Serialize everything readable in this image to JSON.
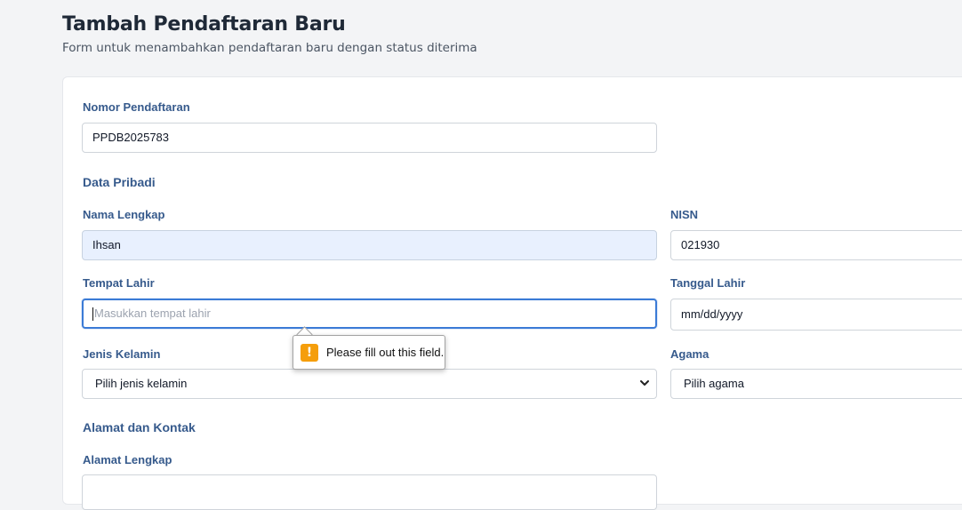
{
  "header": {
    "title": "Tambah Pendaftaran Baru",
    "subtitle": "Form untuk menambahkan pendaftaran baru dengan status diterima"
  },
  "form": {
    "nomor": {
      "label": "Nomor Pendaftaran",
      "value": "PPDB2025783"
    },
    "section_pribadi": "Data Pribadi",
    "nama": {
      "label": "Nama Lengkap",
      "value": "Ihsan"
    },
    "nisn": {
      "label": "NISN",
      "value": "021930"
    },
    "tempat_lahir": {
      "label": "Tempat Lahir",
      "value": "",
      "placeholder": "Masukkan tempat lahir"
    },
    "tanggal_lahir": {
      "label": "Tanggal Lahir",
      "value": "mm/dd/yyyy"
    },
    "jenis_kelamin": {
      "label": "Jenis Kelamin",
      "value": "Pilih jenis kelamin"
    },
    "agama": {
      "label": "Agama",
      "value": "Pilih agama"
    },
    "section_alamat": "Alamat dan Kontak",
    "alamat": {
      "label": "Alamat Lengkap"
    }
  },
  "validation_tooltip": {
    "icon": "warning-icon",
    "icon_glyph": "!",
    "message": "Please fill out this field."
  },
  "colors": {
    "label": "#365a8c",
    "focus": "#3b7bd6",
    "autofill": "#e8f0fe",
    "warning": "#f59e0b"
  }
}
